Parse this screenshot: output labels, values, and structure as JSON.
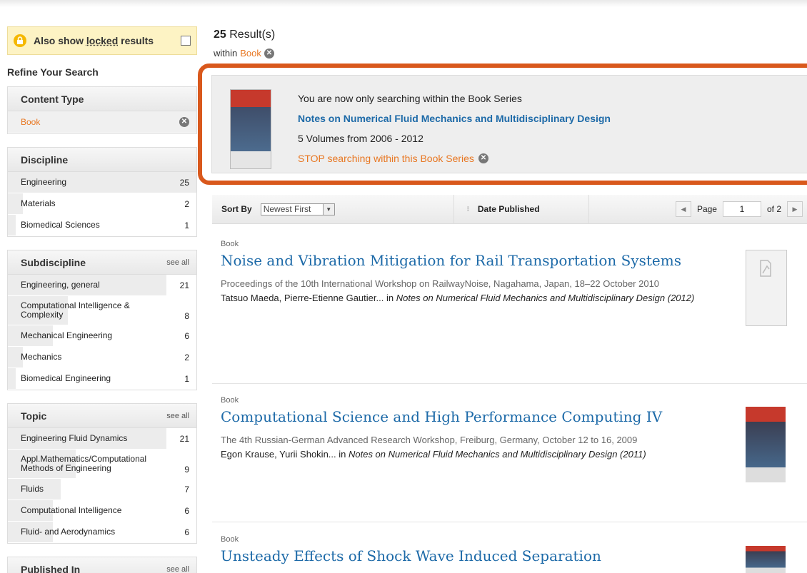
{
  "locked": {
    "label_prefix": "Also show ",
    "label_link": "locked",
    "label_suffix": " results"
  },
  "refine_title": "Refine Your Search",
  "facets": {
    "content_type": {
      "title": "Content Type",
      "items": [
        {
          "label": "Book"
        }
      ]
    },
    "discipline": {
      "title": "Discipline",
      "items": [
        {
          "label": "Engineering",
          "count": "25"
        },
        {
          "label": "Materials",
          "count": "2"
        },
        {
          "label": "Biomedical Sciences",
          "count": "1"
        }
      ]
    },
    "subdiscipline": {
      "title": "Subdiscipline",
      "see_all": "see all",
      "items": [
        {
          "label": "Engineering, general",
          "count": "21"
        },
        {
          "label": "Computational Intelligence & Complexity",
          "count": "8"
        },
        {
          "label": "Mechanical Engineering",
          "count": "6"
        },
        {
          "label": "Mechanics",
          "count": "2"
        },
        {
          "label": "Biomedical Engineering",
          "count": "1"
        }
      ]
    },
    "topic": {
      "title": "Topic",
      "see_all": "see all",
      "items": [
        {
          "label": "Engineering Fluid Dynamics",
          "count": "21"
        },
        {
          "label": "Appl.Mathematics/Computational Methods of Engineering",
          "count": "9"
        },
        {
          "label": "Fluids",
          "count": "7"
        },
        {
          "label": "Computational Intelligence",
          "count": "6"
        },
        {
          "label": "Fluid- and Aerodynamics",
          "count": "6"
        }
      ]
    },
    "published_in": {
      "title": "Published In",
      "see_all": "see all"
    }
  },
  "results_header": {
    "count": "25",
    "label": "Result(s)",
    "within_label": "within",
    "within_value": "Book"
  },
  "series": {
    "intro": "You are now only searching within the Book Series",
    "title": "Notes on Numerical Fluid Mechanics and Multidisciplinary Design",
    "volumes": "5 Volumes from 2006 - 2012",
    "stop": "STOP searching within this Book Series"
  },
  "sortbar": {
    "sort_by": "Sort By",
    "sort_value": "Newest First",
    "date_published": "Date Published",
    "page_label": "Page",
    "page_value": "1",
    "page_of": "of 2"
  },
  "results": [
    {
      "type": "Book",
      "title": "Noise and Vibration Mitigation for Rail Transportation Systems",
      "subtitle": "Proceedings of the 10th International Workshop on RailwayNoise, Nagahama, Japan, 18–22 October 2010",
      "authors": "Tatsuo Maeda, Pierre-Etienne Gautier...",
      "in": " in ",
      "source": "Notes on Numerical Fluid Mechanics and Multidisciplinary Design (2012)"
    },
    {
      "type": "Book",
      "title": "Computational Science and High Performance Computing IV",
      "subtitle": "The 4th Russian-German Advanced Research Workshop, Freiburg, Germany, October 12 to 16, 2009",
      "authors": "Egon Krause, Yurii Shokin...",
      "in": " in ",
      "source": "Notes on Numerical Fluid Mechanics and Multidisciplinary Design (2011)"
    },
    {
      "type": "Book",
      "title": "Unsteady Effects of Shock Wave Induced Separation"
    }
  ],
  "colors": {
    "accent": "#e87722",
    "link": "#1d6aa8",
    "highlight_border": "#d9581c",
    "locked_bg": "#fdf3c4"
  }
}
